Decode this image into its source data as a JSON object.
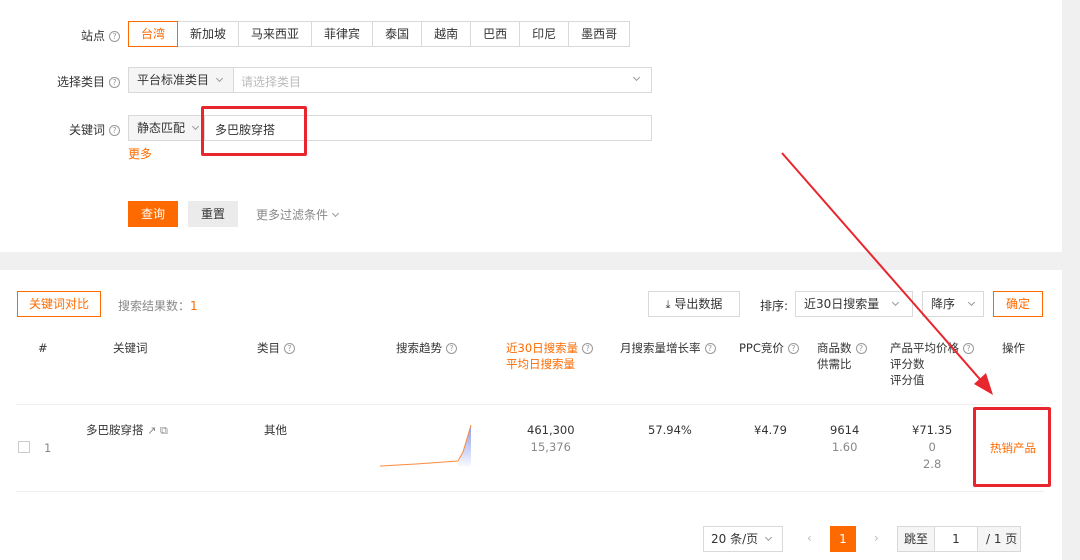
{
  "filters": {
    "site_label": "站点",
    "sites": [
      "台湾",
      "新加坡",
      "马来西亚",
      "菲律宾",
      "泰国",
      "越南",
      "巴西",
      "印尼",
      "墨西哥"
    ],
    "category_label": "选择类目",
    "category_type": "平台标准类目",
    "category_placeholder": "请选择类目",
    "keyword_label": "关键词",
    "match_type": "静态匹配",
    "keyword_value": "多巴胺穿搭",
    "more_label": "更多",
    "query_button": "查询",
    "reset_button": "重置",
    "more_filters": "更多过滤条件"
  },
  "toolbar": {
    "compare_button": "关键词对比",
    "result_count_label": "搜索结果数：",
    "result_count": "1",
    "export_button": "导出数据",
    "sort_label": "排序:",
    "sort_field": "近30日搜索量",
    "sort_order": "降序",
    "confirm_button": "确定"
  },
  "table": {
    "headers": {
      "index": "#",
      "keyword": "关键词",
      "category": "类目",
      "trend": "搜索趋势",
      "search30_line1": "近30日搜索量",
      "search30_line2": "平均日搜索量",
      "growth": "月搜索量增长率",
      "ppc": "PPC竞价",
      "products_line1": "商品数",
      "products_line2": "供需比",
      "price_line1": "产品平均价格",
      "price_line2": "评分数",
      "price_line3": "评分值",
      "action": "操作"
    },
    "rows": [
      {
        "index": "1",
        "keyword": "多巴胺穿搭",
        "category": "其他",
        "search30": "461,300",
        "avg_daily": "15,376",
        "growth": "57.94%",
        "ppc": "¥4.79",
        "products": "9614",
        "supply_demand": "1.60",
        "avg_price": "¥71.35",
        "rating_count": "0",
        "rating_value": "2.8",
        "action": "热销产品"
      }
    ]
  },
  "pagination": {
    "page_size": "20 条/页",
    "current_page": "1",
    "jump_label": "跳至",
    "jump_value": "1",
    "total_pages": "/ 1 页"
  },
  "colors": {
    "accent": "#ff6a00",
    "annotation": "#e8262d"
  }
}
